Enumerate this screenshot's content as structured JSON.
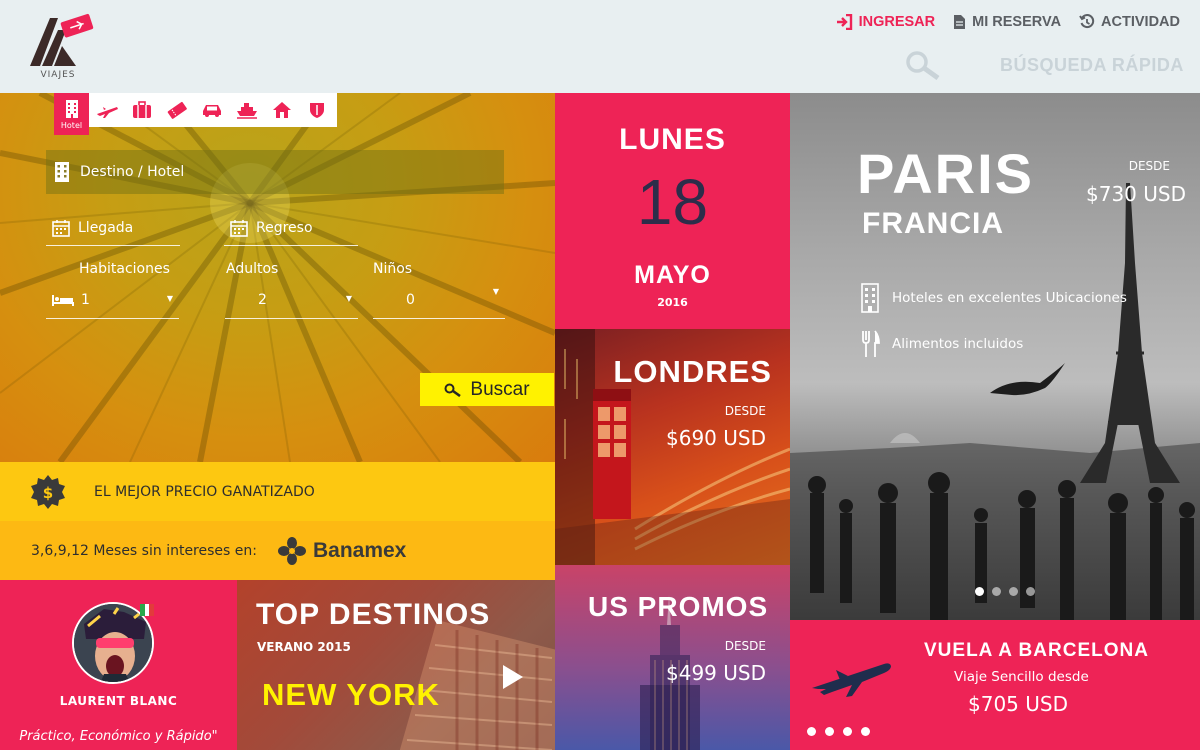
{
  "brand": {
    "name": "VIAJES",
    "accent": "#ee2356",
    "yellow": "#fff200"
  },
  "topnav": {
    "login": "INGRESAR",
    "reservation": "MI RESERVA",
    "activity": "ACTIVIDAD"
  },
  "quick_search": {
    "label": "BÚSQUEDA RÁPIDA",
    "icon": "search-icon"
  },
  "search": {
    "tabs": [
      {
        "icon": "hotel-icon",
        "label": "Hotel",
        "active": true
      },
      {
        "icon": "plane-icon"
      },
      {
        "icon": "luggage-icon"
      },
      {
        "icon": "ticket-icon"
      },
      {
        "icon": "car-icon"
      },
      {
        "icon": "ship-icon"
      },
      {
        "icon": "house-icon"
      },
      {
        "icon": "shield-icon"
      }
    ],
    "destination_placeholder": "Destino / Hotel",
    "checkin_placeholder": "Llegada",
    "checkout_placeholder": "Regreso",
    "rooms": {
      "label": "Habitaciones",
      "value": "1"
    },
    "adults": {
      "label": "Adultos",
      "value": "2"
    },
    "children": {
      "label": "Niños",
      "value": "0"
    },
    "button": "Buscar"
  },
  "promo": {
    "guarantee": "EL MEJOR PRECIO GANATIZADO",
    "installments": "3,6,9,12 Meses sin intereses en:",
    "bank": "Banamex"
  },
  "profile": {
    "name": "LAURENT BLANC",
    "quote": "Práctico, Económico y Rápido\""
  },
  "top_destinos": {
    "title": "TOP DESTINOS",
    "subtitle": "VERANO 2015",
    "city": "NEW YORK"
  },
  "date_tile": {
    "weekday": "LUNES",
    "day": "18",
    "month": "MAYO",
    "year": "2016"
  },
  "londres": {
    "title": "LONDRES",
    "from": "DESDE",
    "price": "$690 USD"
  },
  "us_promos": {
    "title": "US PROMOS",
    "from": "DESDE",
    "price": "$499 USD"
  },
  "paris": {
    "city": "PARIS",
    "country": "FRANCIA",
    "from": "DESDE",
    "price": "$730 USD",
    "features": [
      {
        "icon": "building-icon",
        "text": "Hoteles en excelentes Ubicaciones"
      },
      {
        "icon": "cutlery-icon",
        "text": "Alimentos incluidos"
      }
    ],
    "slide_count": 4,
    "active_slide": 1
  },
  "barcelona": {
    "title": "VUELA A BARCELONA",
    "subtitle": "Viaje Sencillo desde",
    "price": "$705 USD",
    "slide_count": 4,
    "active_slide": 1
  }
}
